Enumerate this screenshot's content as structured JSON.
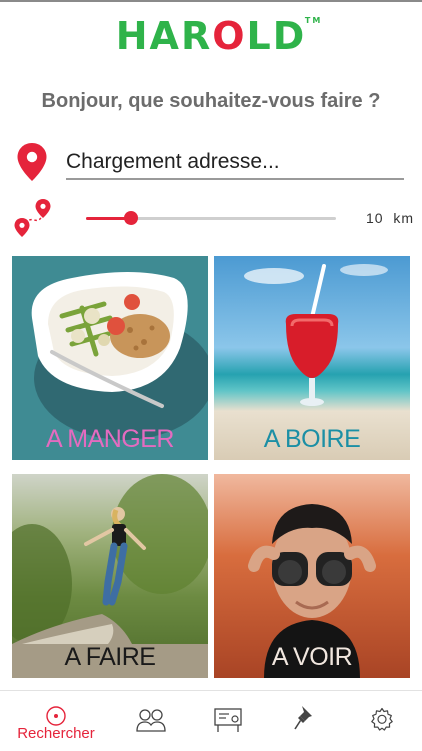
{
  "app": {
    "logo_letters": [
      "H",
      "A",
      "R",
      "O",
      "L",
      "D"
    ],
    "logo_tm": "TM",
    "greeting": "Bonjour, que souhaitez-vous faire ?",
    "accent_color": "#e5243b",
    "brand_color": "#2fb34a"
  },
  "location": {
    "address_value": "Chargement adresse...",
    "icon": "location-pin-icon"
  },
  "radius": {
    "icon": "route-icon",
    "distance_value": "10",
    "distance_unit": "km",
    "slider_fraction": 0.18
  },
  "categories": [
    {
      "label": "A MANGER",
      "label_color": "#e46bc0",
      "image": "food-bowl"
    },
    {
      "label": "A BOIRE",
      "label_color": "#1b8fa5",
      "image": "cocktail-beach"
    },
    {
      "label": "A FAIRE",
      "label_color": "#1a1a1a",
      "image": "jumping-woman"
    },
    {
      "label": "A VOIR",
      "label_color": "#f1e7df",
      "image": "man-binoculars"
    }
  ],
  "nav": [
    {
      "id": "search",
      "label": "Rechercher",
      "icon": "search-target-icon",
      "active": true
    },
    {
      "id": "friends",
      "label": "",
      "icon": "people-icon",
      "active": false
    },
    {
      "id": "events",
      "label": "",
      "icon": "presentation-icon",
      "active": false
    },
    {
      "id": "saved",
      "label": "",
      "icon": "pushpin-icon",
      "active": false
    },
    {
      "id": "settings",
      "label": "",
      "icon": "gear-icon",
      "active": false
    }
  ]
}
